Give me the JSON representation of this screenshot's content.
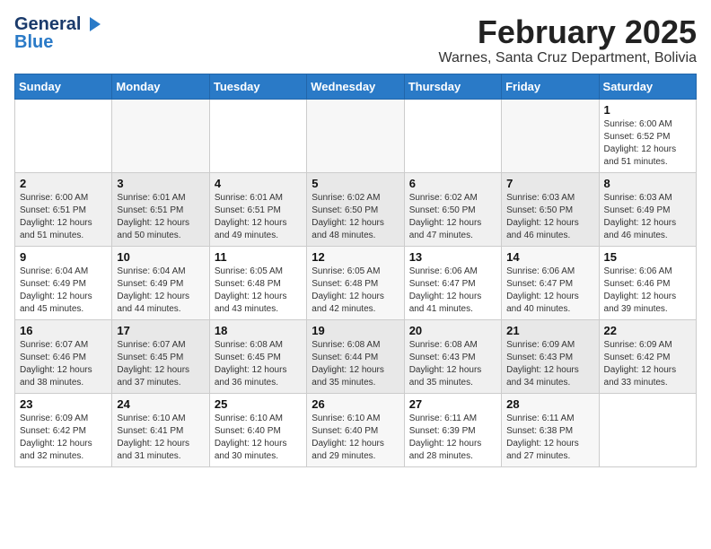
{
  "header": {
    "logo_line1": "General",
    "logo_line2": "Blue",
    "month_year": "February 2025",
    "location": "Warnes, Santa Cruz Department, Bolivia"
  },
  "days_of_week": [
    "Sunday",
    "Monday",
    "Tuesday",
    "Wednesday",
    "Thursday",
    "Friday",
    "Saturday"
  ],
  "weeks": [
    [
      {
        "day": "",
        "info": ""
      },
      {
        "day": "",
        "info": ""
      },
      {
        "day": "",
        "info": ""
      },
      {
        "day": "",
        "info": ""
      },
      {
        "day": "",
        "info": ""
      },
      {
        "day": "",
        "info": ""
      },
      {
        "day": "1",
        "info": "Sunrise: 6:00 AM\nSunset: 6:52 PM\nDaylight: 12 hours\nand 51 minutes."
      }
    ],
    [
      {
        "day": "2",
        "info": "Sunrise: 6:00 AM\nSunset: 6:51 PM\nDaylight: 12 hours\nand 51 minutes."
      },
      {
        "day": "3",
        "info": "Sunrise: 6:01 AM\nSunset: 6:51 PM\nDaylight: 12 hours\nand 50 minutes."
      },
      {
        "day": "4",
        "info": "Sunrise: 6:01 AM\nSunset: 6:51 PM\nDaylight: 12 hours\nand 49 minutes."
      },
      {
        "day": "5",
        "info": "Sunrise: 6:02 AM\nSunset: 6:50 PM\nDaylight: 12 hours\nand 48 minutes."
      },
      {
        "day": "6",
        "info": "Sunrise: 6:02 AM\nSunset: 6:50 PM\nDaylight: 12 hours\nand 47 minutes."
      },
      {
        "day": "7",
        "info": "Sunrise: 6:03 AM\nSunset: 6:50 PM\nDaylight: 12 hours\nand 46 minutes."
      },
      {
        "day": "8",
        "info": "Sunrise: 6:03 AM\nSunset: 6:49 PM\nDaylight: 12 hours\nand 46 minutes."
      }
    ],
    [
      {
        "day": "9",
        "info": "Sunrise: 6:04 AM\nSunset: 6:49 PM\nDaylight: 12 hours\nand 45 minutes."
      },
      {
        "day": "10",
        "info": "Sunrise: 6:04 AM\nSunset: 6:49 PM\nDaylight: 12 hours\nand 44 minutes."
      },
      {
        "day": "11",
        "info": "Sunrise: 6:05 AM\nSunset: 6:48 PM\nDaylight: 12 hours\nand 43 minutes."
      },
      {
        "day": "12",
        "info": "Sunrise: 6:05 AM\nSunset: 6:48 PM\nDaylight: 12 hours\nand 42 minutes."
      },
      {
        "day": "13",
        "info": "Sunrise: 6:06 AM\nSunset: 6:47 PM\nDaylight: 12 hours\nand 41 minutes."
      },
      {
        "day": "14",
        "info": "Sunrise: 6:06 AM\nSunset: 6:47 PM\nDaylight: 12 hours\nand 40 minutes."
      },
      {
        "day": "15",
        "info": "Sunrise: 6:06 AM\nSunset: 6:46 PM\nDaylight: 12 hours\nand 39 minutes."
      }
    ],
    [
      {
        "day": "16",
        "info": "Sunrise: 6:07 AM\nSunset: 6:46 PM\nDaylight: 12 hours\nand 38 minutes."
      },
      {
        "day": "17",
        "info": "Sunrise: 6:07 AM\nSunset: 6:45 PM\nDaylight: 12 hours\nand 37 minutes."
      },
      {
        "day": "18",
        "info": "Sunrise: 6:08 AM\nSunset: 6:45 PM\nDaylight: 12 hours\nand 36 minutes."
      },
      {
        "day": "19",
        "info": "Sunrise: 6:08 AM\nSunset: 6:44 PM\nDaylight: 12 hours\nand 35 minutes."
      },
      {
        "day": "20",
        "info": "Sunrise: 6:08 AM\nSunset: 6:43 PM\nDaylight: 12 hours\nand 35 minutes."
      },
      {
        "day": "21",
        "info": "Sunrise: 6:09 AM\nSunset: 6:43 PM\nDaylight: 12 hours\nand 34 minutes."
      },
      {
        "day": "22",
        "info": "Sunrise: 6:09 AM\nSunset: 6:42 PM\nDaylight: 12 hours\nand 33 minutes."
      }
    ],
    [
      {
        "day": "23",
        "info": "Sunrise: 6:09 AM\nSunset: 6:42 PM\nDaylight: 12 hours\nand 32 minutes."
      },
      {
        "day": "24",
        "info": "Sunrise: 6:10 AM\nSunset: 6:41 PM\nDaylight: 12 hours\nand 31 minutes."
      },
      {
        "day": "25",
        "info": "Sunrise: 6:10 AM\nSunset: 6:40 PM\nDaylight: 12 hours\nand 30 minutes."
      },
      {
        "day": "26",
        "info": "Sunrise: 6:10 AM\nSunset: 6:40 PM\nDaylight: 12 hours\nand 29 minutes."
      },
      {
        "day": "27",
        "info": "Sunrise: 6:11 AM\nSunset: 6:39 PM\nDaylight: 12 hours\nand 28 minutes."
      },
      {
        "day": "28",
        "info": "Sunrise: 6:11 AM\nSunset: 6:38 PM\nDaylight: 12 hours\nand 27 minutes."
      },
      {
        "day": "",
        "info": ""
      }
    ]
  ]
}
